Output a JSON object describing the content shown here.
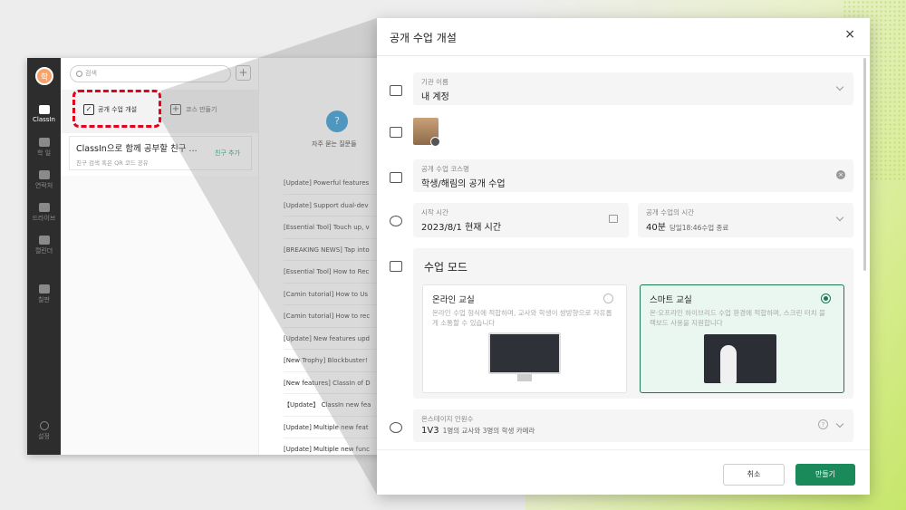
{
  "app": {
    "avatar": "학",
    "search_placeholder": "검색",
    "rail": [
      {
        "label": "ClassIn"
      },
      {
        "label": "학 일"
      },
      {
        "label": "연락처"
      },
      {
        "label": "드라이브"
      },
      {
        "label": "캘린더"
      },
      {
        "label": "칠판"
      }
    ],
    "settings_label": "설정",
    "open_class_label": "공개 수업 개설",
    "create_course_label": "코스 만들기",
    "friend_card": {
      "title": "ClassIn으로 함께 공부할 친구 ...",
      "subtitle": "친구 검색 혹은 QR 코드 공유",
      "add_label": "친구 추가"
    },
    "faq_label": "자주 묻는 질문들",
    "notices": [
      "[Update] Powerful features",
      "[Update] Support dual-dev",
      "[Essential Tool] Touch up, v",
      "[BREAKING NEWS] Tap into",
      "[Essential Tool] How to Rec",
      "[Camin tutorial] How to Us",
      "[Camin tutorial] How to rec",
      "[Update] New features upd",
      "[New Trophy] Blockbuster!",
      "[New features] ClassIn of D",
      "【Update】 ClassIn new fea",
      "[Update] Multiple new feat",
      "[Update] Multiple new func"
    ]
  },
  "dialog": {
    "title": "공개 수업 개설",
    "org": {
      "label": "기관 이름",
      "value": "내 계정"
    },
    "course_name": {
      "label": "공개 수업 코스명",
      "value": "학생/해림의 공개 수업"
    },
    "start": {
      "label": "시작 시간",
      "value": "2023/8/1 현재 시간"
    },
    "duration": {
      "label": "공개 수업의 시간",
      "value": "40분",
      "note": "당일18:46수업 종료"
    },
    "mode": {
      "title": "수업 모드",
      "online": {
        "title": "온라인 교실",
        "desc": "온라인 수업 형식에 적합하며, 교사와 학생이 쌍방향으로 자유롭게 소통할 수 있습니다"
      },
      "smart": {
        "title": "스마트 교실",
        "desc": "온·오프라인 하이브리드 수업 환경에 적합하며, 스크린 터치 블랙보드 사용을 지원합니다"
      }
    },
    "stage": {
      "label": "온스테이지 인원수",
      "value": "1V3",
      "note": "1명의 교사와 3명의 학생 카메라"
    },
    "cancel_label": "취소",
    "create_label": "만들기"
  },
  "colors": {
    "accent": "#1a8a5a",
    "highlight": "#e3001b",
    "faq": "#2c99d6"
  }
}
